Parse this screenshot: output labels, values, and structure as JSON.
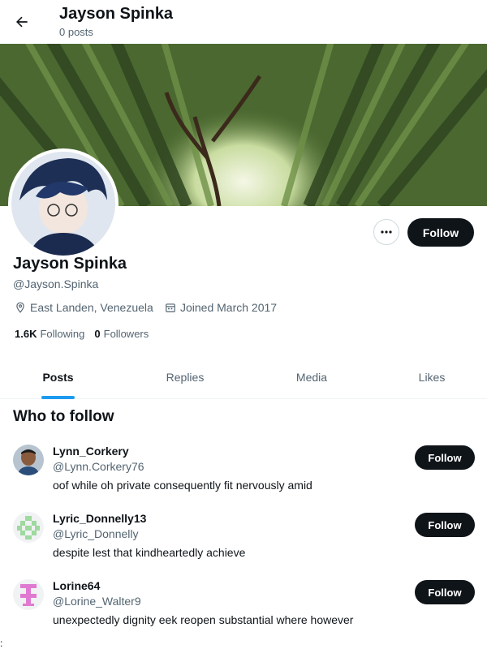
{
  "header": {
    "title": "Jayson Spinka",
    "post_count": "0 posts"
  },
  "profile": {
    "name": "Jayson Spinka",
    "handle": "@Jayson.Spinka",
    "location": "East Landen, Venezuela",
    "joined": "Joined March 2017",
    "following_count": "1.6K",
    "following_label": "Following",
    "followers_count": "0",
    "followers_label": "Followers",
    "follow_label": "Follow"
  },
  "tabs": [
    {
      "label": "Posts",
      "active": true
    },
    {
      "label": "Replies",
      "active": false
    },
    {
      "label": "Media",
      "active": false
    },
    {
      "label": "Likes",
      "active": false
    }
  ],
  "who_to_follow": {
    "title": "Who to follow",
    "suggestions": [
      {
        "name": "Lynn_Corkery",
        "handle": "@Lynn.Corkery76",
        "bio": "oof while oh private consequently fit nervously amid",
        "follow_label": "Follow"
      },
      {
        "name": "Lyric_Donnelly13",
        "handle": "@Lyric_Donnelly",
        "bio": "despite lest that kindheartedly achieve",
        "follow_label": "Follow"
      },
      {
        "name": "Lorine64",
        "handle": "@Lorine_Walter9",
        "bio": "unexpectedly dignity eek reopen substantial where however",
        "follow_label": "Follow"
      }
    ]
  },
  "stray_text": ":",
  "colors": {
    "accent": "#1d9bf0",
    "button_dark": "#0f1419",
    "secondary_text": "#536471",
    "identicon_green": "#9ed99e",
    "identicon_pink": "#e07ad0"
  }
}
